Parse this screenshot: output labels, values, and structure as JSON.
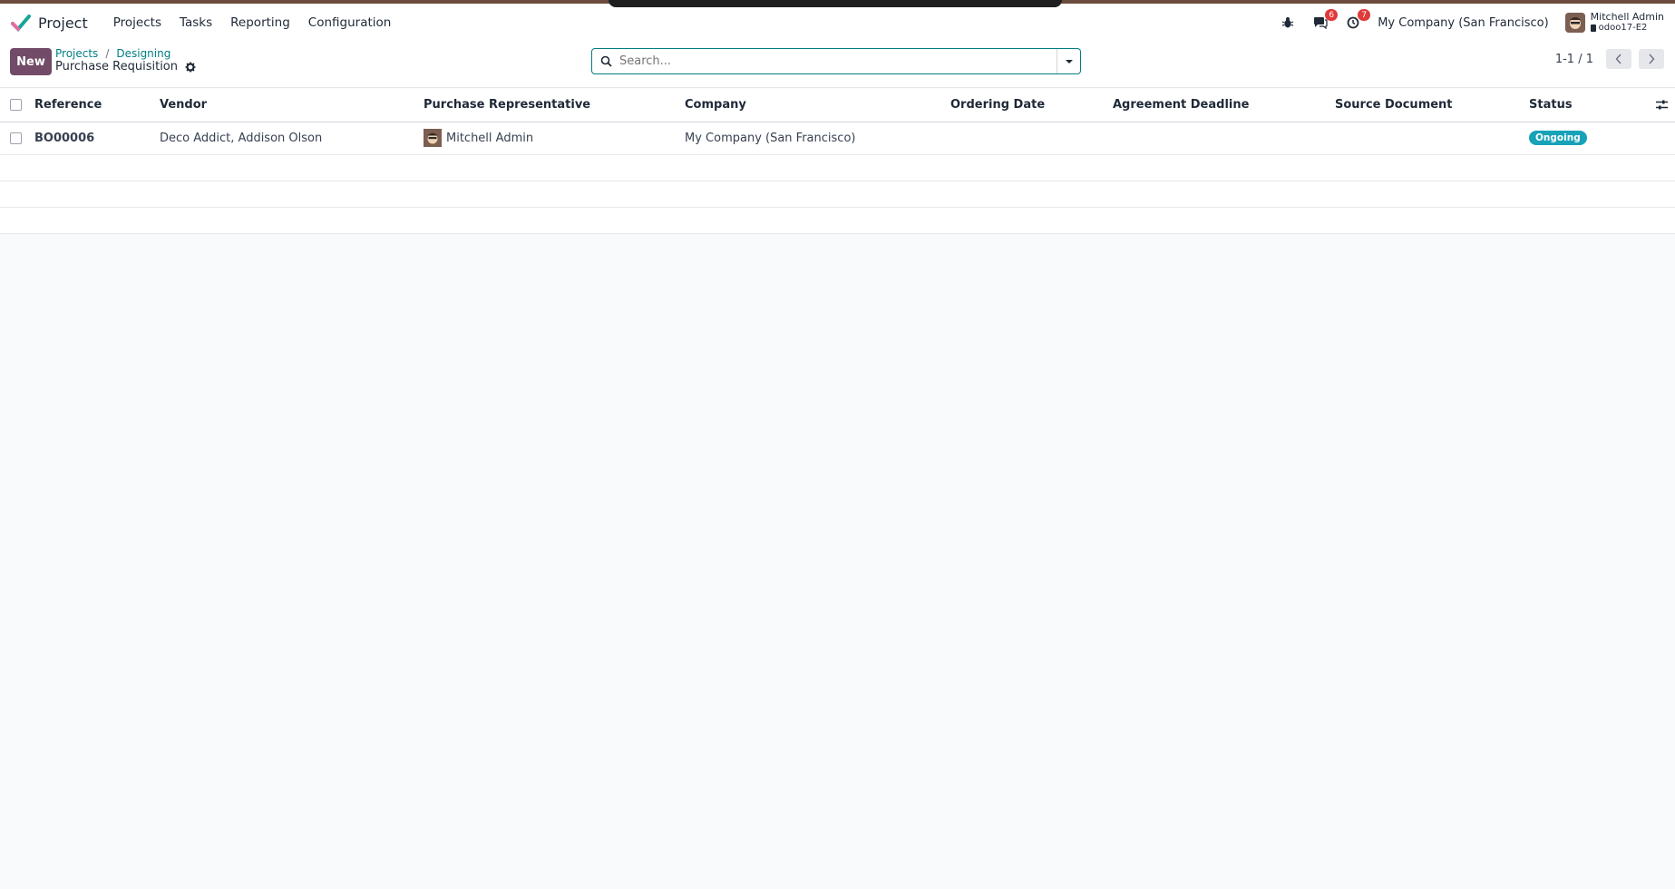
{
  "navbar": {
    "app_name": "Project",
    "menu": [
      "Projects",
      "Tasks",
      "Reporting",
      "Configuration"
    ],
    "messages_count": "6",
    "activities_count": "7",
    "company": "My Company (San Francisco)",
    "user_name": "Mitchell Admin",
    "user_db": "odoo17-E2"
  },
  "control_panel": {
    "new_label": "New",
    "breadcrumb": [
      "Projects",
      "Designing"
    ],
    "title": "Purchase Requisition",
    "search_placeholder": "Search...",
    "pager": "1-1 / 1"
  },
  "table": {
    "columns": [
      "Reference",
      "Vendor",
      "Purchase Representative",
      "Company",
      "Ordering Date",
      "Agreement Deadline",
      "Source Document",
      "Status"
    ],
    "rows": [
      {
        "reference": "BO00006",
        "vendor": "Deco Addict, Addison Olson",
        "representative": "Mitchell Admin",
        "company": "My Company (San Francisco)",
        "ordering_date": "",
        "agreement_deadline": "",
        "source_document": "",
        "status": "Ongoing"
      }
    ]
  },
  "colors": {
    "primary": "#714b67",
    "link": "#017e84",
    "status_ongoing": "#17a2b8",
    "badge": "#e03a3a"
  },
  "icons": [
    "app-logo-icon",
    "bug-icon",
    "chat-icon",
    "clock-icon",
    "gear-icon",
    "search-icon",
    "caret-down-icon",
    "chevron-left-icon",
    "chevron-right-icon",
    "sliders-icon"
  ]
}
